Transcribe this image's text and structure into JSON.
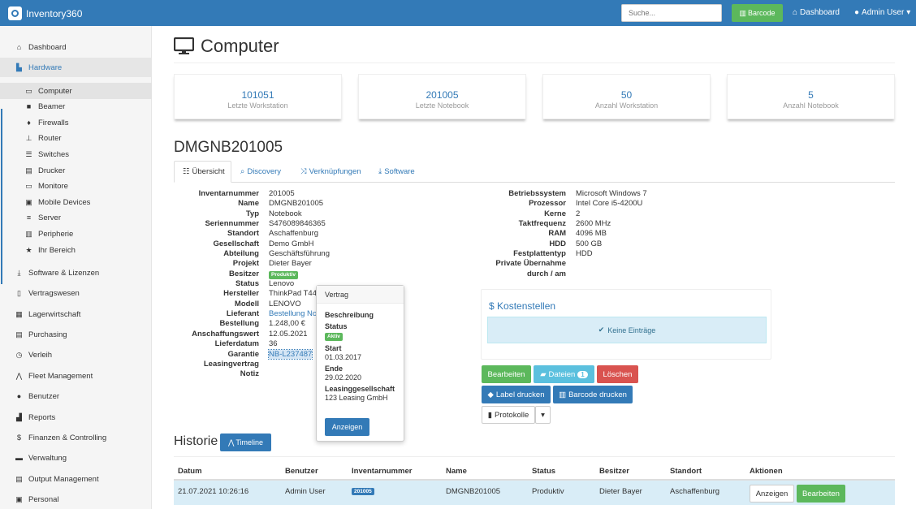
{
  "app": {
    "title": "Inventory360"
  },
  "topbar": {
    "search_placeholder": "Suche...",
    "barcode_label": "Barcode",
    "dashboard_label": "Dashboard",
    "user_label": "Admin User"
  },
  "sidebar": {
    "items": [
      {
        "label": "Dashboard",
        "icon": "home-icon"
      },
      {
        "label": "Hardware",
        "icon": "hardware-icon"
      },
      {
        "label": "Software & Lizenzen",
        "icon": "download-icon"
      },
      {
        "label": "Vertragswesen",
        "icon": "file-icon"
      },
      {
        "label": "Lagerwirtschaft",
        "icon": "grid-icon"
      },
      {
        "label": "Purchasing",
        "icon": "list-icon"
      },
      {
        "label": "Verleih",
        "icon": "clock-icon"
      },
      {
        "label": "Fleet Management",
        "icon": "road-icon"
      },
      {
        "label": "Benutzer",
        "icon": "user-icon"
      },
      {
        "label": "Reports",
        "icon": "stats-icon"
      },
      {
        "label": "Finanzen & Controlling",
        "icon": "dollar-icon"
      },
      {
        "label": "Verwaltung",
        "icon": "folder-icon"
      },
      {
        "label": "Output Management",
        "icon": "print-icon"
      },
      {
        "label": "Personal",
        "icon": "lock-icon"
      }
    ],
    "subitems": [
      {
        "label": "Computer"
      },
      {
        "label": "Beamer"
      },
      {
        "label": "Firewalls"
      },
      {
        "label": "Router"
      },
      {
        "label": "Switches"
      },
      {
        "label": "Drucker"
      },
      {
        "label": "Monitore"
      },
      {
        "label": "Mobile Devices"
      },
      {
        "label": "Server"
      },
      {
        "label": "Peripherie"
      },
      {
        "label": "Ihr Bereich"
      }
    ]
  },
  "page": {
    "title": "Computer"
  },
  "stats": [
    {
      "value": "101051",
      "label": "Letzte Workstation"
    },
    {
      "value": "201005",
      "label": "Letzte Notebook"
    },
    {
      "value": "50",
      "label": "Anzahl Workstation"
    },
    {
      "value": "5",
      "label": "Anzahl Notebook"
    }
  ],
  "device": {
    "name": "DMGNB201005"
  },
  "tabs": [
    {
      "label": "Übersicht"
    },
    {
      "label": "Discovery"
    },
    {
      "label": "Verknüpfungen"
    },
    {
      "label": "Software"
    }
  ],
  "details_left": [
    {
      "key": "Inventarnummer",
      "value": "201005"
    },
    {
      "key": "Name",
      "value": "DMGNB201005"
    },
    {
      "key": "Typ",
      "value": "Notebook"
    },
    {
      "key": "Seriennummer",
      "value": "S476089846365"
    },
    {
      "key": "Standort",
      "value": "Aschaffenburg"
    },
    {
      "key": "Gesellschaft",
      "value": "Demo GmbH"
    },
    {
      "key": "Abteilung",
      "value": "Geschäftsführung"
    },
    {
      "key": "Projekt",
      "value": ""
    },
    {
      "key": "Besitzer",
      "value": "Dieter Bayer"
    },
    {
      "key": "Status",
      "value": "Produktiv"
    },
    {
      "key": "Hersteller",
      "value": "Lenovo"
    },
    {
      "key": "Modell",
      "value": "ThinkPad T440"
    },
    {
      "key": "Lieferant",
      "value": "LENOVO"
    },
    {
      "key": "Bestellung",
      "value": "Bestellung Not"
    },
    {
      "key": "Anschaffungswert",
      "value": "1.248,00 €"
    },
    {
      "key": "Lieferdatum",
      "value": "12.05.2021"
    },
    {
      "key": "Garantie",
      "value": "36"
    },
    {
      "key": "Leasingvertrag",
      "value": "NB-L237487"
    },
    {
      "key": "Notiz",
      "value": ""
    }
  ],
  "details_right": [
    {
      "key": "Betriebssystem",
      "value": "Microsoft Windows 7"
    },
    {
      "key": "Prozessor",
      "value": "Intel Core i5-4200U"
    },
    {
      "key": "Kerne",
      "value": "2"
    },
    {
      "key": "Taktfrequenz",
      "value": "2600 MHz"
    },
    {
      "key": "RAM",
      "value": "4096 MB"
    },
    {
      "key": "HDD",
      "value": "500 GB"
    },
    {
      "key": "Festplattentyp",
      "value": "HDD"
    },
    {
      "key": "Private Übernahme",
      "value": ""
    },
    {
      "key": "durch / am",
      "value": ""
    }
  ],
  "popover": {
    "title": "Vertrag",
    "beschreibung_label": "Beschreibung",
    "status_label": "Status",
    "status_value": "Aktiv",
    "start_label": "Start",
    "start_value": "01.03.2017",
    "ende_label": "Ende",
    "ende_value": "29.02.2020",
    "gesellschaft_label": "Leasinggesellschaft",
    "gesellschaft_value": "123 Leasing GmbH",
    "button_label": "Anzeigen"
  },
  "kosten": {
    "title": "Kostenstellen",
    "empty_text": "Keine Einträge"
  },
  "actions": {
    "bearbeiten": "Bearbeiten",
    "dateien": "Dateien",
    "dateien_count": "1",
    "loeschen": "Löschen",
    "label_drucken": "Label drucken",
    "barcode_drucken": "Barcode drucken",
    "protokolle": "Protokolle"
  },
  "history": {
    "title": "Historie",
    "timeline_label": "Timeline",
    "columns": [
      "Datum",
      "Benutzer",
      "Inventarnummer",
      "Name",
      "Status",
      "Besitzer",
      "Standort",
      "Aktionen"
    ],
    "rows": [
      {
        "datum": "21.07.2021 10:26:16",
        "benutzer": "Admin User",
        "inventarnummer": "201005",
        "name": "DMGNB201005",
        "status": "Produktiv",
        "besitzer": "Dieter Bayer",
        "standort": "Aschaffenburg",
        "btn_anzeigen": "Anzeigen",
        "btn_bearbeiten": "Bearbeiten"
      }
    ]
  },
  "colors": {
    "primary": "#337ab7",
    "success": "#5cb85c",
    "danger": "#d9534f",
    "info": "#5bc0de",
    "info_bg": "#d9edf7"
  }
}
